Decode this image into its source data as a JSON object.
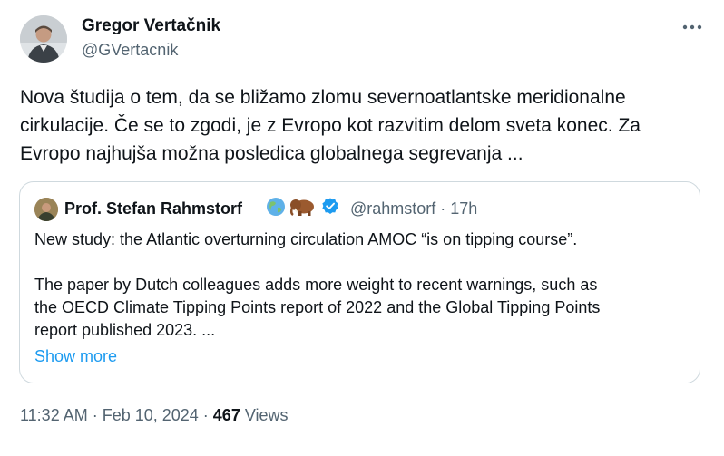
{
  "author": {
    "name": "Gregor Vertačnik",
    "handle": "@GVertacnik"
  },
  "tweet_text": "Nova študija o tem, da se bližamo zlomu severnoatlantske meridionalne\ncirkulacije. Če se to zgodi, je z Evropo kot razvitim delom sveta konec. Za\nEvropo najhujša možna posledica globalnega segrevanja ...",
  "quote": {
    "name": "Prof. Stefan Rahmstorf",
    "badges": [
      "earth-globe-icon",
      "mammoth-icon",
      "verified-badge-icon"
    ],
    "handle_time": "@rahmstorf · 17h",
    "text": "New study: the Atlantic overturning circulation AMOC “is on tipping course”.\n\nThe paper by Dutch colleagues adds more weight to recent warnings, such as\nthe OECD Climate Tipping Points report of 2022 and the Global Tipping Points\nreport published 2023. ...",
    "show_more": "Show more"
  },
  "meta": {
    "timestamp": "11:32 AM · Feb 10, 2024 · ",
    "views_count": "467",
    "views_label": " Views"
  },
  "colors": {
    "text": "#0f1419",
    "secondary": "#536471",
    "link": "#1d9bf0",
    "border": "#cfd9de",
    "verified": "#1d9bf0"
  }
}
